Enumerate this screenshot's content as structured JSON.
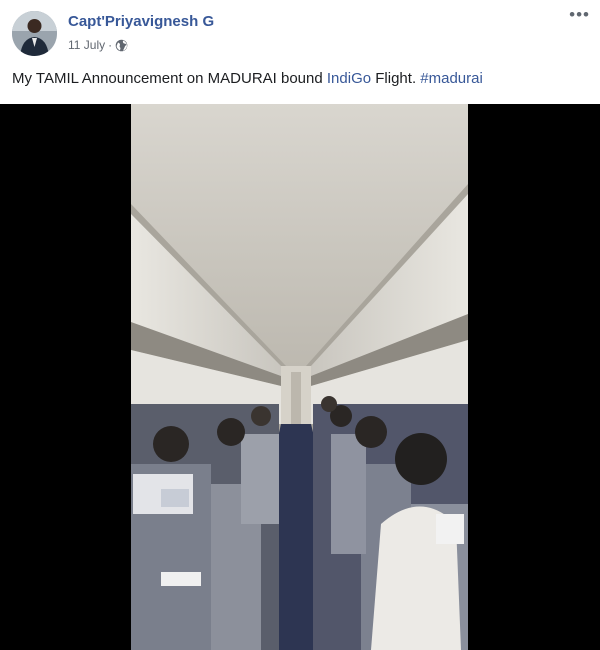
{
  "post": {
    "author": "Capt'Priyavignesh G",
    "date": "11 July",
    "separator": "·",
    "privacy_icon": "globe-icon",
    "more_icon": "more-options-icon",
    "more_label": "•••",
    "text_plain": "My TAMIL Announcement on MADURAI bound ",
    "text_link": "IndiGo",
    "text_mid": " Flight. ",
    "hashtag": "#madurai"
  },
  "video": {
    "description_icon": "video-frame"
  },
  "colors": {
    "link": "#385898",
    "meta": "#616770",
    "video_bg": "#000000"
  }
}
